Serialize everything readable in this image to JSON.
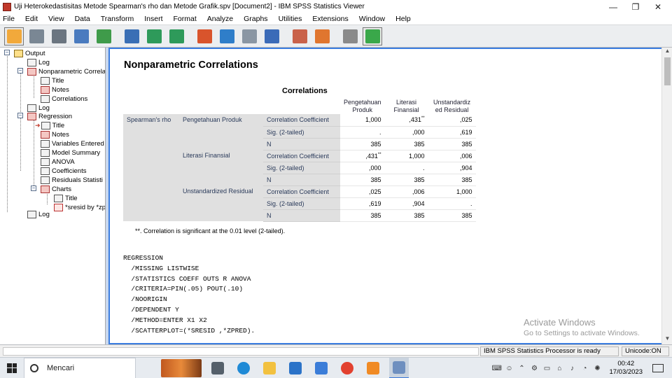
{
  "window": {
    "title": "Uji Heterokedastisitas Metode Spearman's rho dan Metode Grafik.spv [Document2] - IBM SPSS Statistics Viewer",
    "controls": {
      "minimize": "—",
      "maximize": "❐",
      "close": "✕"
    }
  },
  "menu": [
    "File",
    "Edit",
    "View",
    "Data",
    "Transform",
    "Insert",
    "Format",
    "Analyze",
    "Graphs",
    "Utilities",
    "Extensions",
    "Window",
    "Help"
  ],
  "toolbar": {
    "icons": [
      {
        "name": "open-icon",
        "color": "#f2a93b"
      },
      {
        "name": "save-icon",
        "color": "#7a8794"
      },
      {
        "name": "print-icon",
        "color": "#6b7580"
      },
      {
        "name": "print-preview-icon",
        "color": "#4a7bbf"
      },
      {
        "name": "export-icon",
        "color": "#3f9b4a"
      },
      {
        "name": "recall-dialog-icon",
        "color": "#3a6fb5"
      },
      {
        "name": "undo-icon",
        "color": "#2e9a5a"
      },
      {
        "name": "redo-icon",
        "color": "#2e9a5a"
      },
      {
        "name": "goto-data-icon",
        "color": "#d9542c"
      },
      {
        "name": "goto-case-icon",
        "color": "#2f7ec9"
      },
      {
        "name": "goto-variable-icon",
        "color": "#8a96a3"
      },
      {
        "name": "variables-icon",
        "color": "#3b6bb8"
      },
      {
        "name": "show-all-icon",
        "color": "#c9624a"
      },
      {
        "name": "script-icon",
        "color": "#e0762f"
      },
      {
        "name": "hide-icon",
        "color": "#8a8a8a"
      },
      {
        "name": "insert-output-icon",
        "color": "#3aa84a"
      }
    ]
  },
  "tree": {
    "items": [
      {
        "label": "Output",
        "icon": "output-book-icon"
      },
      {
        "label": "Log",
        "icon": "log-icon"
      },
      {
        "label": "Nonparametric Correla",
        "icon": "procedure-icon"
      },
      {
        "label": "Title",
        "icon": "title-icon"
      },
      {
        "label": "Notes",
        "icon": "notes-icon"
      },
      {
        "label": "Correlations",
        "icon": "table-icon"
      },
      {
        "label": "Log",
        "icon": "log-icon"
      },
      {
        "label": "Regression",
        "icon": "procedure-icon"
      },
      {
        "label": "Title",
        "icon": "title-icon"
      },
      {
        "label": "Notes",
        "icon": "notes-icon"
      },
      {
        "label": "Variables Entered",
        "icon": "table-icon"
      },
      {
        "label": "Model Summary",
        "icon": "table-icon"
      },
      {
        "label": "ANOVA",
        "icon": "table-icon"
      },
      {
        "label": "Coefficients",
        "icon": "table-icon"
      },
      {
        "label": "Residuals Statisti",
        "icon": "table-icon"
      },
      {
        "label": "Charts",
        "icon": "procedure-icon"
      },
      {
        "label": "Title",
        "icon": "title-icon"
      },
      {
        "label": "*sresid by *zp",
        "icon": "chart-icon"
      },
      {
        "label": "Log",
        "icon": "log-icon"
      }
    ]
  },
  "output": {
    "section_title": "Nonparametric Correlations",
    "table_title": "Correlations",
    "col_headers": [
      [
        "Pengetahuan",
        "Produk"
      ],
      [
        "Literasi",
        "Finansial"
      ],
      [
        "Unstandardiz",
        "ed Residual"
      ]
    ],
    "row_group": "Spearman's rho",
    "var_labels": [
      "Pengetahuan Produk",
      "Literasi Finansial",
      "Unstandardized Residual"
    ],
    "stat_labels": [
      "Correlation Coefficient",
      "Sig. (2-tailed)",
      "N"
    ],
    "rows": [
      [
        "1,000",
        ",431",
        ",025"
      ],
      [
        ".",
        ",000",
        ",619"
      ],
      [
        "385",
        "385",
        "385"
      ],
      [
        ",431",
        "1,000",
        ",006"
      ],
      [
        ",000",
        ".",
        ",904"
      ],
      [
        "385",
        "385",
        "385"
      ],
      [
        ",025",
        ",006",
        "1,000"
      ],
      [
        ",619",
        ",904",
        "."
      ],
      [
        "385",
        "385",
        "385"
      ]
    ],
    "significance_mark": "**",
    "footnote": "**. Correlation is significant at the 0.01 level (2-tailed).",
    "syntax": [
      "REGRESSION",
      "  /MISSING LISTWISE",
      "  /STATISTICS COEFF OUTS R ANOVA",
      "  /CRITERIA=PIN(.05) POUT(.10)",
      "  /NOORIGIN",
      "  /DEPENDENT Y",
      "  /METHOD=ENTER X1 X2",
      "  /SCATTERPLOT=(*SRESID ,*ZPRED)."
    ]
  },
  "watermark": {
    "line1": "Activate Windows",
    "line2": "Go to Settings to activate Windows."
  },
  "status": {
    "processor": "IBM SPSS Statistics Processor is ready",
    "encoding": "Unicode:ON"
  },
  "taskbar": {
    "search_label": "Mencari",
    "apps": [
      {
        "name": "task-view-icon",
        "color": "#55606b"
      },
      {
        "name": "edge-icon",
        "color": "#1f8ad6"
      },
      {
        "name": "file-explorer-icon",
        "color": "#f2c140"
      },
      {
        "name": "mail-icon",
        "color": "#2b73c8"
      },
      {
        "name": "store-icon",
        "color": "#3b7dd8"
      },
      {
        "name": "chrome-icon",
        "color": "#e2412f"
      },
      {
        "name": "app-orange-icon",
        "color": "#f08a24"
      },
      {
        "name": "spss-icon",
        "color": "#6e8fbf"
      }
    ],
    "time": "00:42",
    "date": "17/03/2023"
  }
}
